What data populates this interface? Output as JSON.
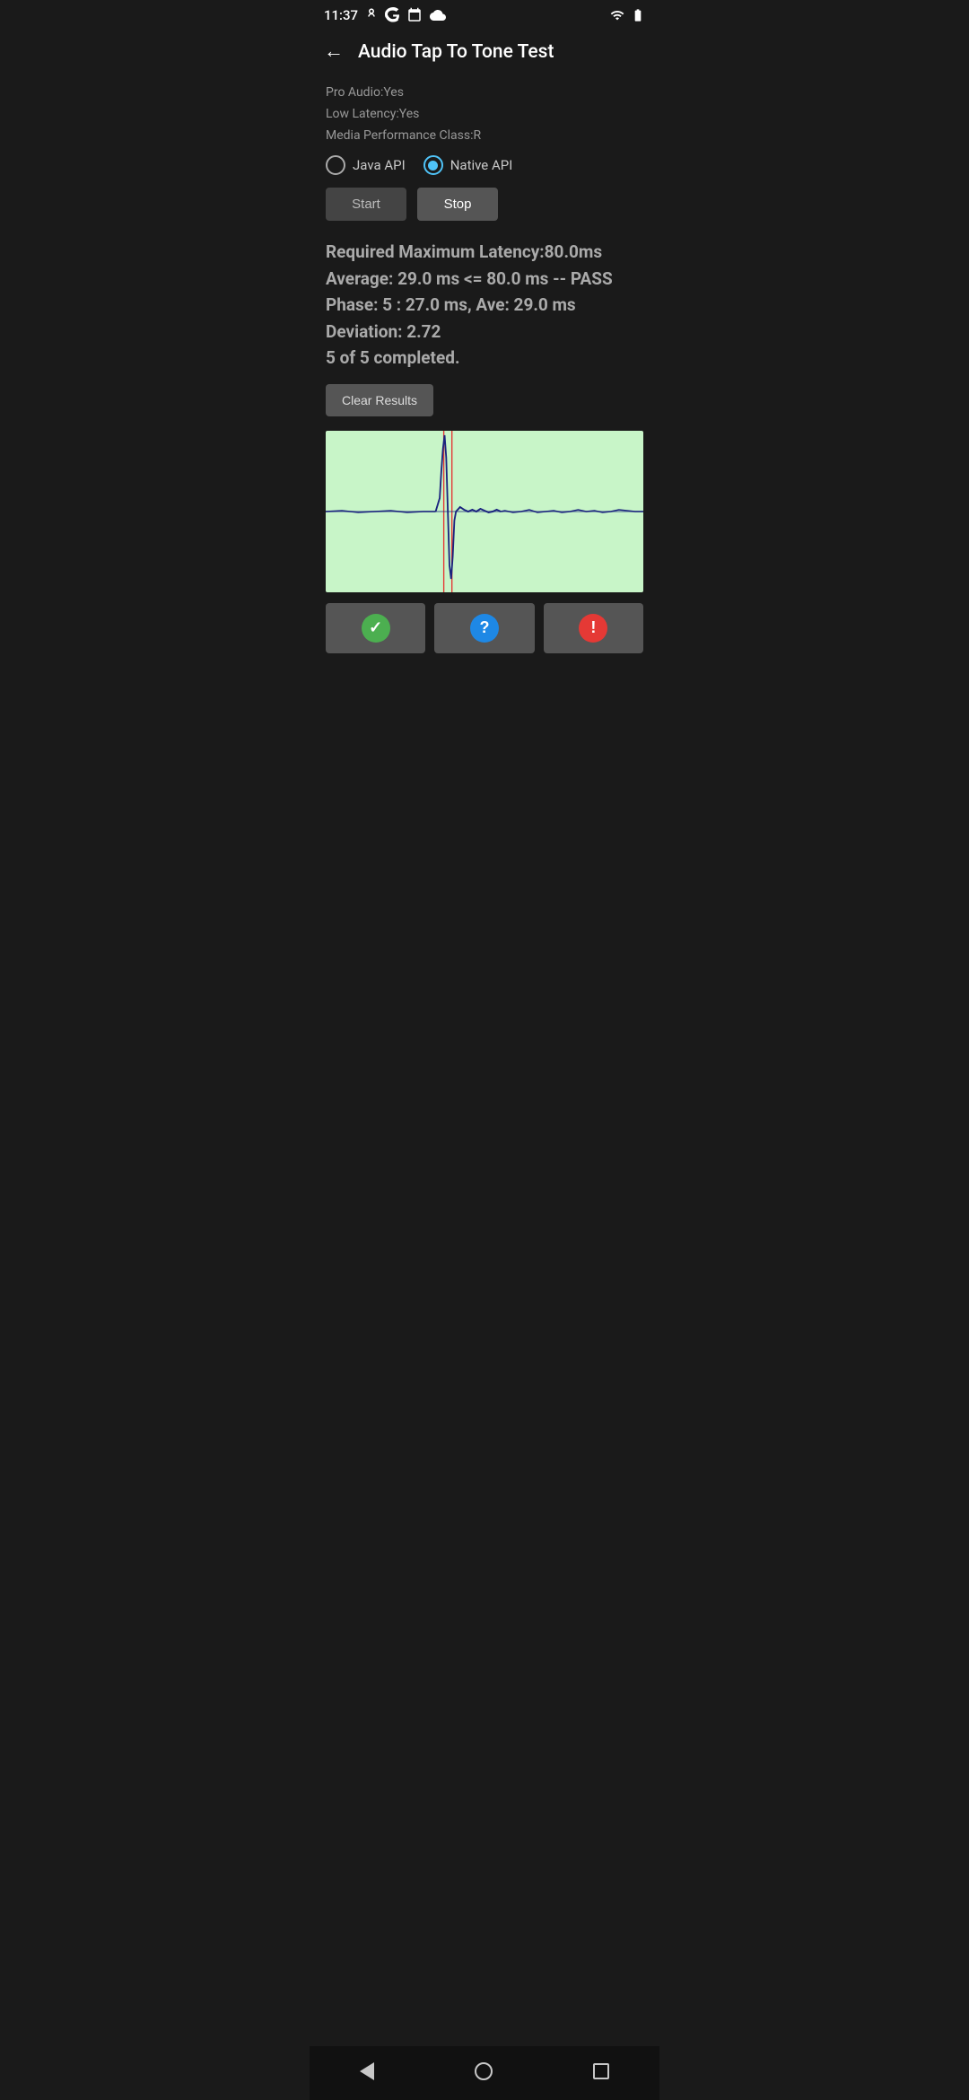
{
  "statusBar": {
    "time": "11:37"
  },
  "appBar": {
    "title": "Audio Tap To Tone Test",
    "backLabel": "←"
  },
  "deviceInfo": {
    "proAudio": "Pro Audio:Yes",
    "lowLatency": "Low Latency:Yes",
    "mediaPerf": "Media Performance Class:R"
  },
  "radioGroup": {
    "options": [
      {
        "label": "Java API",
        "selected": false
      },
      {
        "label": "Native API",
        "selected": true
      }
    ]
  },
  "buttons": {
    "start": "Start",
    "stop": "Stop"
  },
  "results": {
    "line1": "Required Maximum Latency:80.0ms",
    "line2": "Average: 29.0 ms <= 80.0 ms -- PASS",
    "line3": "Phase: 5 : 27.0 ms, Ave: 29.0 ms",
    "line4": "Deviation: 2.72",
    "line5": "5 of 5 completed."
  },
  "clearBtn": "Clear Results",
  "icons": {
    "check": "✓",
    "question": "?",
    "exclaim": "!"
  }
}
